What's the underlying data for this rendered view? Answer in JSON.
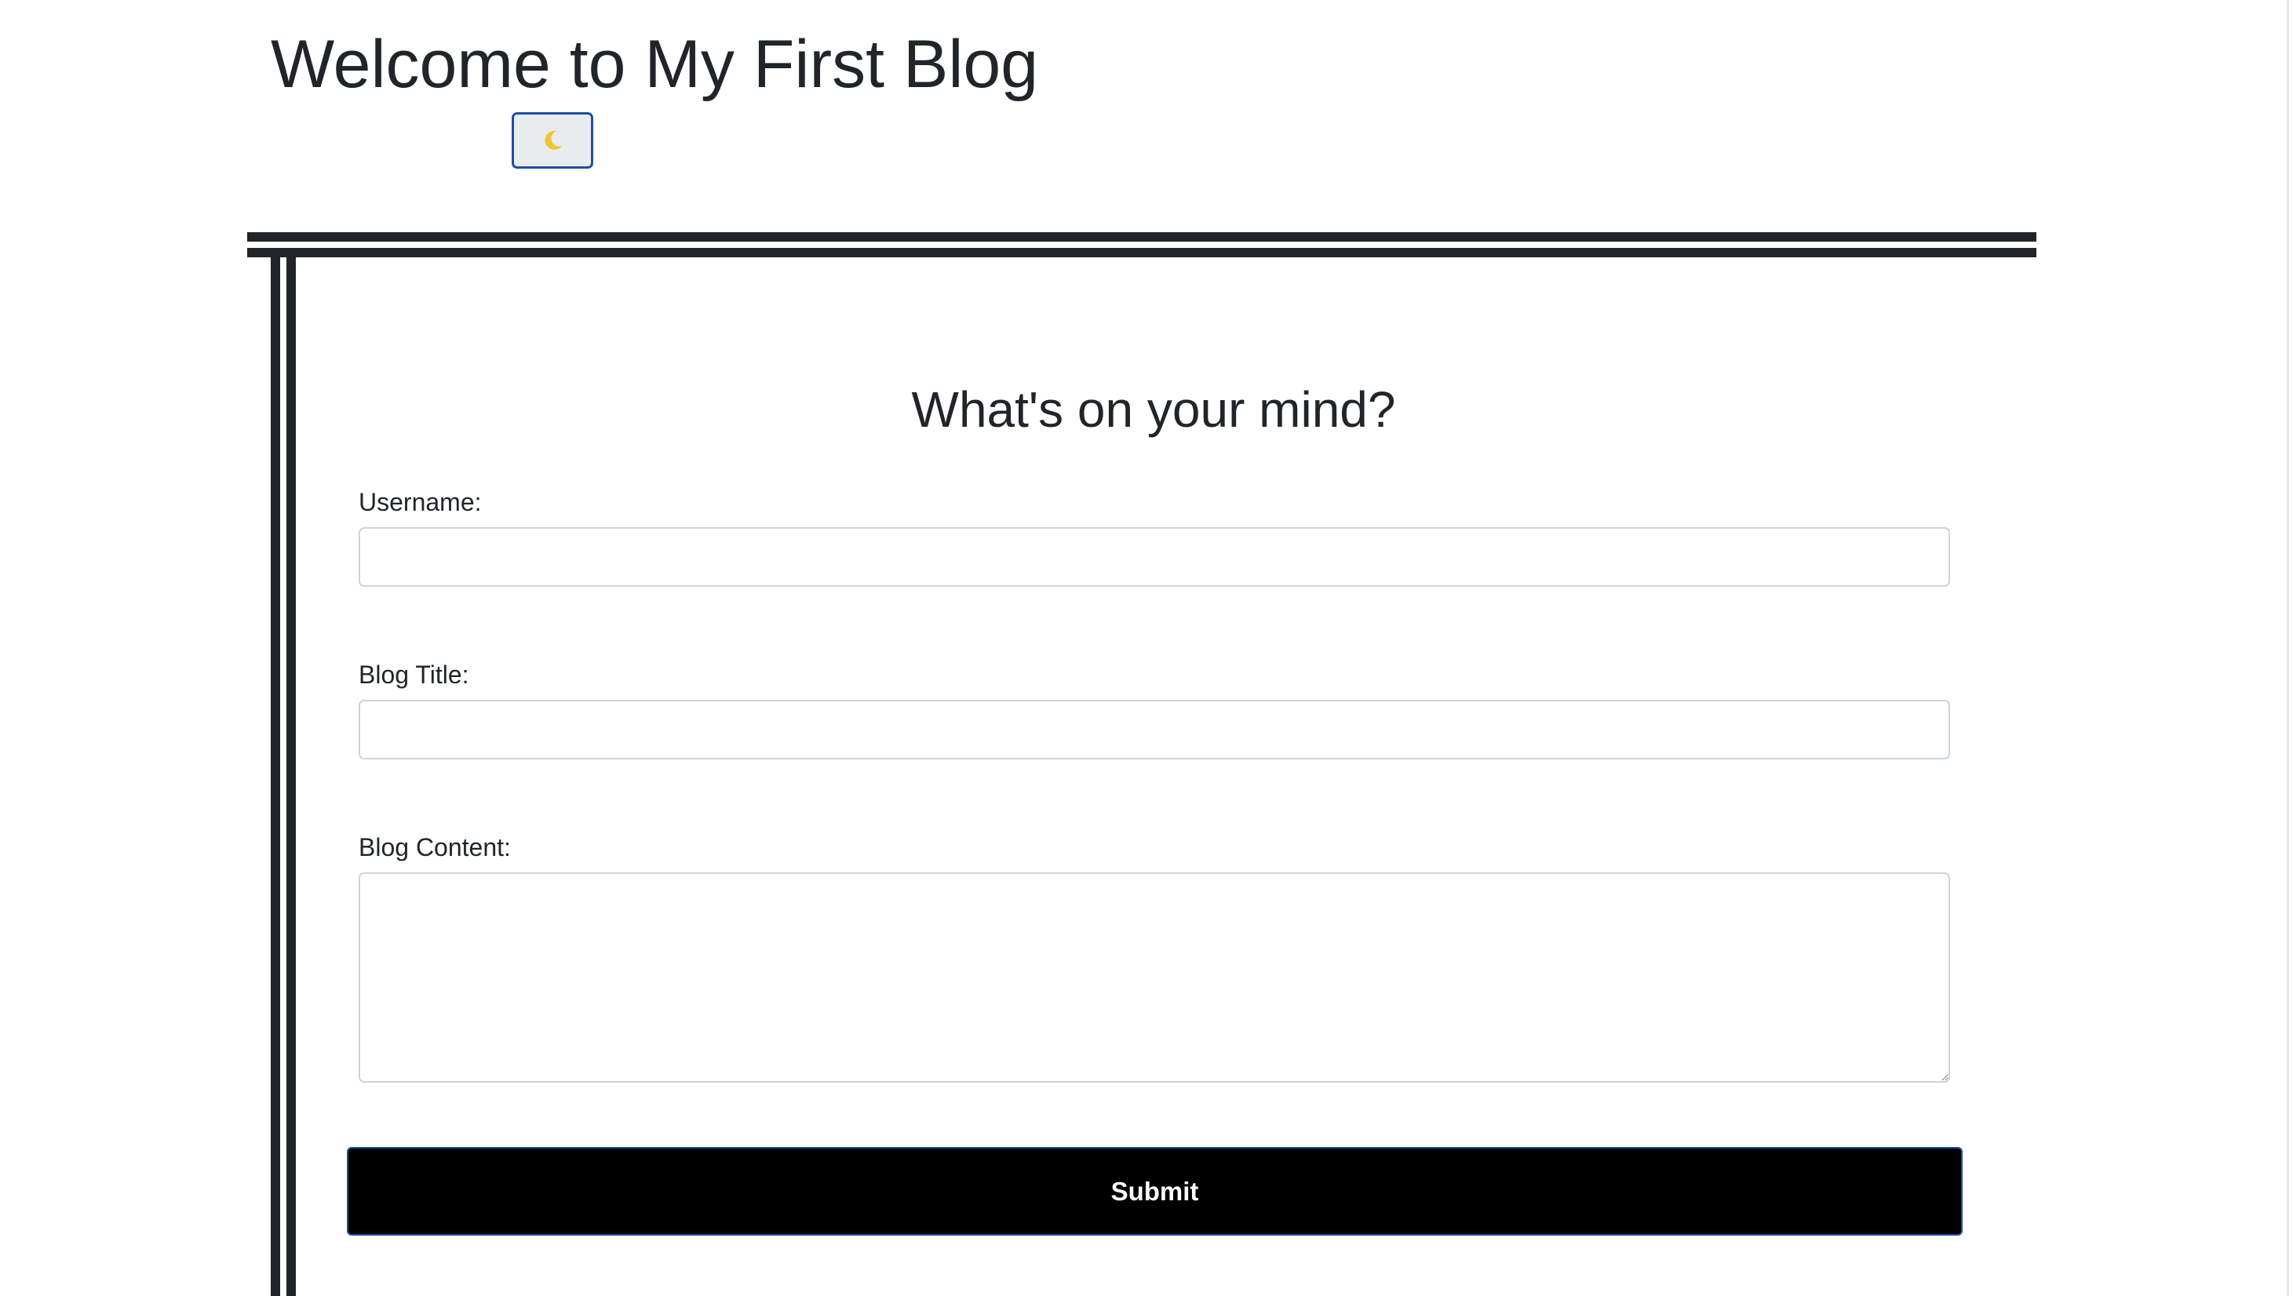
{
  "header": {
    "title": "Welcome to My First Blog",
    "theme_toggle_icon": "crescent-moon-icon"
  },
  "form": {
    "heading": "What's on your mind?",
    "username": {
      "label": "Username:",
      "value": "",
      "placeholder": ""
    },
    "blog_title": {
      "label": "Blog Title:",
      "value": "",
      "placeholder": ""
    },
    "blog_content": {
      "label": "Blog Content:",
      "value": "",
      "placeholder": ""
    },
    "submit_label": "Submit"
  },
  "colors": {
    "text": "#212529",
    "borders": "#212529",
    "submit_background": "#000000",
    "focus_outline": "#1f4fa3",
    "moon": "#f2c230"
  }
}
